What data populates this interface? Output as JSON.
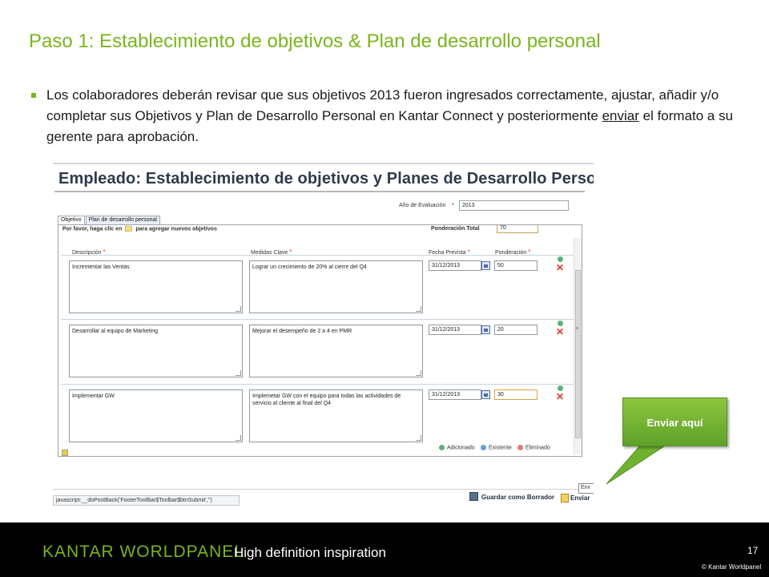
{
  "slide": {
    "title": "Paso 1: Establecimiento de objetivos & Plan de desarrollo personal",
    "bullet_before": "Los colaboradores deberán revisar que sus objetivos 2013 fueron ingresados correctamente, ajustar, añadir y/o completar sus Objetivos y Plan de Desarrollo Personal en Kantar Connect y posteriormente ",
    "bullet_link": "enviar",
    "bullet_after": " el formato a su gerente para aprobación."
  },
  "app": {
    "title": "Empleado: Establecimiento de objetivos y Planes de Desarrollo Personal",
    "year_label": "Año de Evaluación",
    "year_value": "2013",
    "required_mark": "*",
    "tabs": [
      {
        "label": "Objetivo",
        "active": true
      },
      {
        "label": "Plan de desarrollo personal",
        "active": false
      }
    ],
    "hint_before": "Por favor, haga clic en",
    "hint_after": "para agregar nuevos objetivos",
    "total_label": "Ponderación Total",
    "total_value": "70",
    "columns": {
      "description": "Descripción",
      "measures": "Medidas Clave",
      "date": "Fecha Prevista",
      "weight": "Ponderación"
    },
    "rows": [
      {
        "description": "Incrementar las Ventas",
        "measures": "Lograr un crecimiento de 20% al cierre del Q4",
        "date": "31/12/2013",
        "weight": "50"
      },
      {
        "description": "Desarrollar al equipo de Marketing",
        "measures": "Mejorar el desempeño de 2 a 4 en PMR",
        "date": "31/12/2013",
        "weight": "20"
      },
      {
        "description": "Implementar GW",
        "measures": "Implemetar GW con el equipo para todas las actividades de servicio al cliente al final del Q4",
        "date": "31/12/2013",
        "weight": "30"
      }
    ],
    "legend": [
      {
        "label": "Adicionado",
        "color": "#5eb07a"
      },
      {
        "label": "Existente",
        "color": "#6b9bd8"
      },
      {
        "label": "Eliminado",
        "color": "#e07a7a"
      }
    ],
    "status_text": "javascript:__doPostBack('FooterToolBar$Toolbar$btnSubmit','')",
    "save_label": "Guardar como Borrador",
    "send_label": "Enviar",
    "send_tooltip": "Env"
  },
  "callout": {
    "label": "Enviar aquí"
  },
  "footer": {
    "brand": "KANTAR WORLDPANEL",
    "tagline": "High definition inspiration",
    "page_number": "17",
    "copyright": "© Kantar Worldpanel"
  },
  "colors": {
    "accent": "#7ab51d",
    "footer_bg": "#000000",
    "callout": "#6fb230",
    "required": "#e03c3c",
    "delete": "#d63b2a"
  }
}
